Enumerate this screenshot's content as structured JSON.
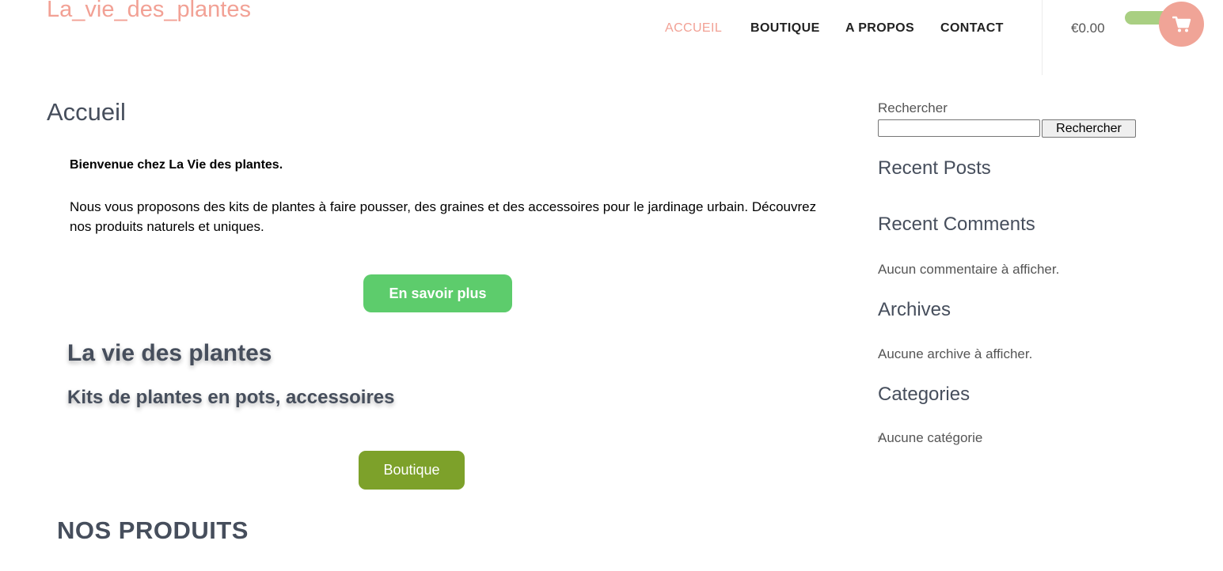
{
  "header": {
    "site_title": "La_vie_des_plantes",
    "nav": [
      {
        "label": "ACCUEIL",
        "active": true
      },
      {
        "label": "BOUTIQUE",
        "active": false
      },
      {
        "label": "A PROPOS",
        "active": false
      },
      {
        "label": "CONTACT",
        "active": false
      }
    ],
    "cart_total": "€0.00",
    "cart_icon": "shopping-cart-icon"
  },
  "main": {
    "page_title": "Accueil",
    "welcome": "Bienvenue chez La Vie des plantes.",
    "intro": "Nous vous proposons des kits de plantes à faire pousser, des graines et des accessoires pour le jardinage urbain. Découvrez nos produits naturels et uniques.",
    "cta_primary": "En savoir plus",
    "heading_plants": "La vie des plantes",
    "heading_kits": "Kits de plantes en pots, accessoires",
    "cta_shop": "Boutique",
    "heading_products": "NOS PRODUITS"
  },
  "sidebar": {
    "search_label": "Rechercher",
    "search_value": "",
    "search_button": "Rechercher",
    "recent_posts_title": "Recent Posts",
    "recent_comments_title": "Recent Comments",
    "recent_comments_empty": "Aucun commentaire à afficher.",
    "archives_title": "Archives",
    "archives_empty": "Aucune archive à afficher.",
    "categories_title": "Categories",
    "categories_empty": "Aucune catégorie"
  },
  "colors": {
    "accent_pink": "#f2a195",
    "button_green": "#5dcc6c",
    "button_olive": "#7da12a",
    "heading_slate": "#464e5c"
  }
}
